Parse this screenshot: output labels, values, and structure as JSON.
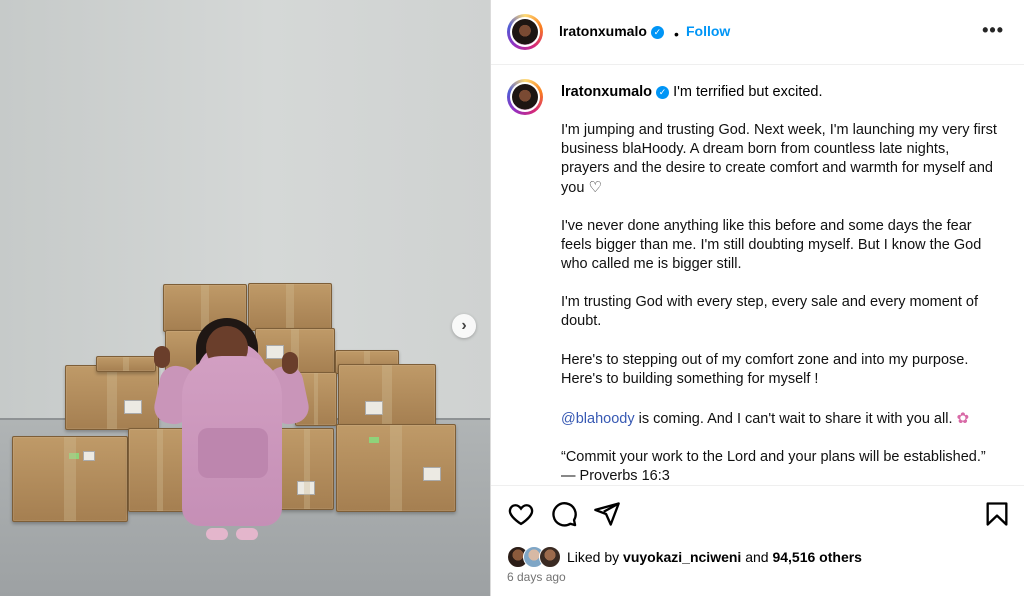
{
  "post": {
    "username": "lratonxumalo",
    "follow_label": "Follow",
    "dot": "•",
    "more_label": "•••",
    "caption_first": "I'm terrified but excited.",
    "paragraphs": [
      "I'm jumping and trusting God. Next week, I'm launching my very first business blaHoody. A dream born from countless late nights, prayers and the desire to create comfort and warmth for myself and you",
      "I've never done anything like this before and some days the fear feels bigger than me. I'm still doubting myself. But I know the God who called me is bigger still.",
      "I'm trusting God with every step, every sale and every moment of doubt.",
      "Here's to stepping out of my comfort zone and into my purpose. Here's to building something for myself !",
      "is coming. And I can't wait to share it with you all.",
      "“Commit your work to the Lord and your plans will be established.” — Proverbs 16:3"
    ],
    "heart_glyph": "♡",
    "flower_glyph": "✿",
    "mention": "@blahoody",
    "next_glyph": "›",
    "liked_by_prefix": "Liked by",
    "liked_by_user": "vuyokazi_nciweni",
    "liked_by_and": "and",
    "likes_count": "94,516 others",
    "time_ago": "6 days ago"
  },
  "icons": [
    "heart-icon",
    "comment-icon",
    "share-icon",
    "bookmark-icon",
    "verified-icon",
    "next-arrow-icon",
    "more-icon"
  ],
  "colors": {
    "accent": "#0095f6",
    "mention": "#3759b3",
    "muted": "#737373"
  }
}
